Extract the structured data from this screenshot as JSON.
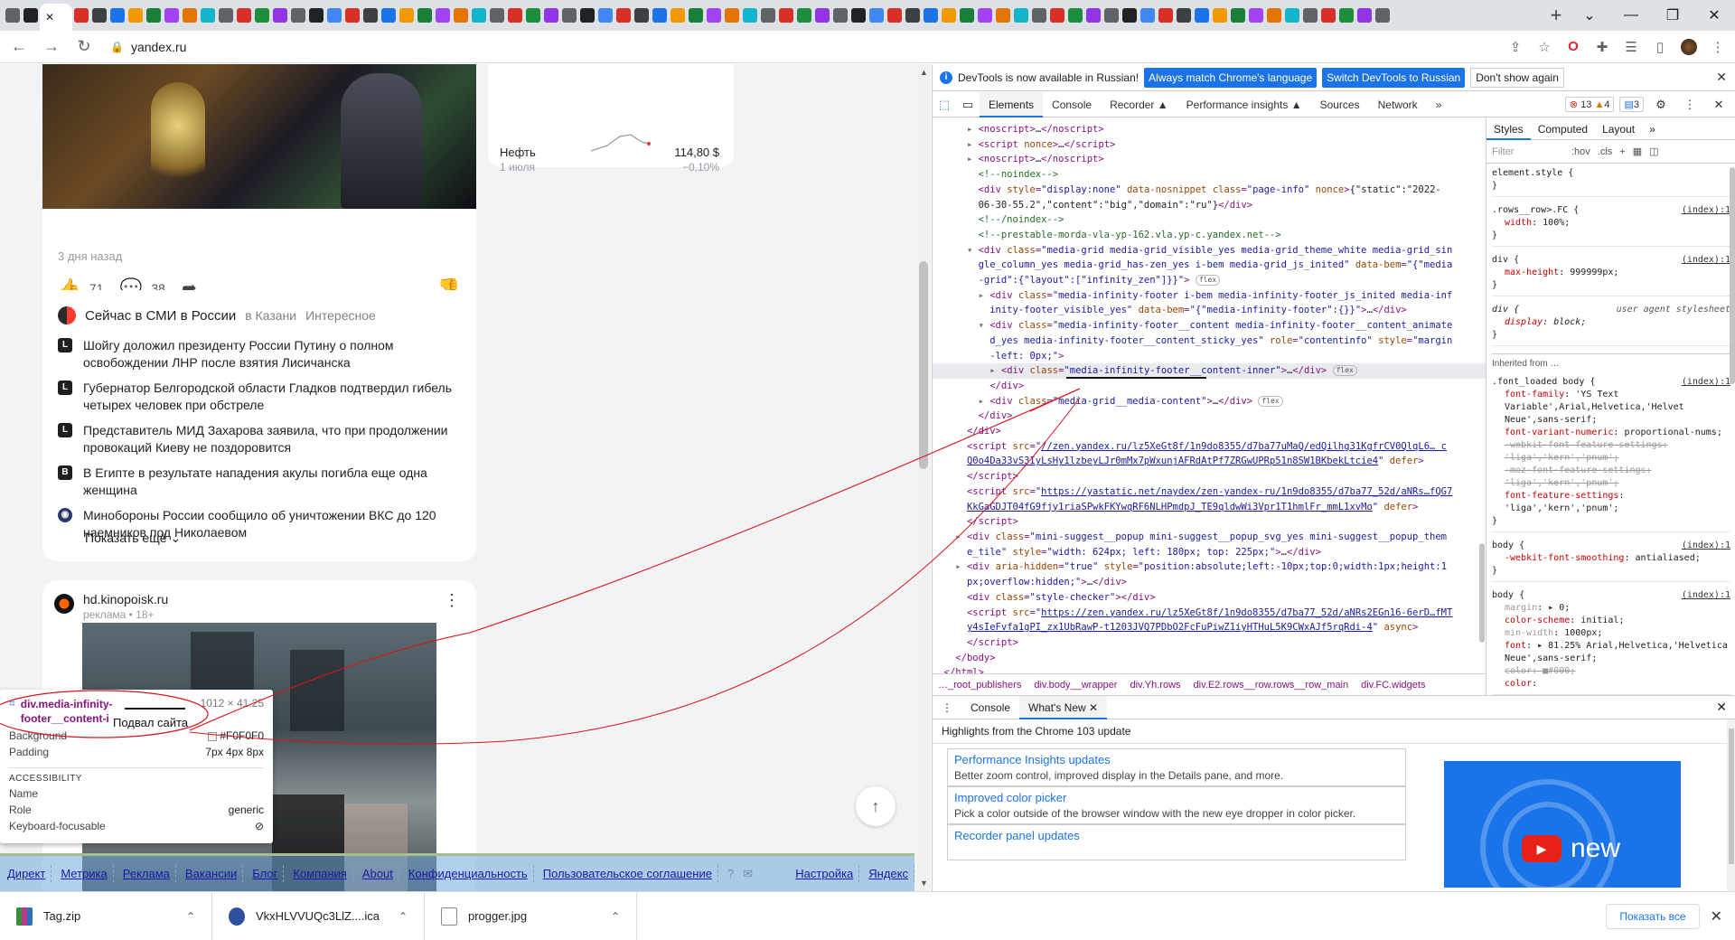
{
  "browser": {
    "url": "yandex.ru",
    "new_tab": "+",
    "win_min": "—",
    "win_max": "❐",
    "win_close": "✕",
    "back": "←",
    "forward": "→",
    "reload": "↻",
    "lock": "🔒",
    "active_tab_close": "✕"
  },
  "page": {
    "card1": {
      "date": "3 дня назад",
      "likes": "71",
      "comments": "38"
    },
    "oil": {
      "name": "Нефть",
      "date": "1 июля",
      "value": "114,80 $",
      "change": "−0,10%"
    },
    "news": {
      "title": "Сейчас в СМИ в России",
      "tab1": "в Казани",
      "tab2": "Интересное",
      "items": [
        {
          "src": "L",
          "text": "Шойгу доложил президенту России Путину о полном освобождении ЛНР после взятия Лисичанска"
        },
        {
          "src": "L",
          "text": "Губернатор Белгородской области Гладков подтвердил гибель четырех человек при обстреле"
        },
        {
          "src": "L",
          "text": "Представитель МИД Захарова заявила, что при продолжении провокаций Киеву не поздоровится"
        },
        {
          "src": "B",
          "text": "В Египте в результате нападения акулы погибла еще одна женщина"
        },
        {
          "src": "◉",
          "text": "Минобороны России сообщило об уничтожении ВКС до 120 наемников под Николаевом"
        }
      ],
      "more": "Показать ещё"
    },
    "ad": {
      "site": "hd.kinopoisk.ru",
      "label": "реклама • 18+"
    },
    "footer_links": [
      "Директ",
      "Метрика",
      "Реклама",
      "Вакансии",
      "Блог",
      "Компания",
      "About",
      "Конфиденциальность",
      "Пользовательское соглашение"
    ],
    "footer_right": [
      "Настройка",
      "Яндекс"
    ],
    "footer_label": "Подвал сайта"
  },
  "inspect": {
    "selector": "div.media-infinity-footer__content-inner",
    "dims": "1012 × 41.25",
    "background_label": "Background",
    "background_value": "#F0F0F0",
    "padding_label": "Padding",
    "padding_value": "7px 4px 8px",
    "accessibility": "ACCESSIBILITY",
    "name_label": "Name",
    "role_label": "Role",
    "role_value": "generic",
    "kb_label": "Keyboard-focusable",
    "kb_value": "⊘"
  },
  "devtools": {
    "banner_text": "DevTools is now available in Russian!",
    "banner_btn1": "Always match Chrome's language",
    "banner_btn2": "Switch DevTools to Russian",
    "banner_btn3": "Don't show again",
    "tabs": [
      "Elements",
      "Console",
      "Recorder ▲",
      "Performance insights ▲",
      "Sources",
      "Network",
      "»"
    ],
    "errors": "13",
    "warnings": "4",
    "issues": "3",
    "breadcrumbs": [
      "…_root_publishers",
      "div.body__wrapper",
      "div.Yh.rows",
      "div.E2.rows__row.rows__row_main",
      "div.FC.widgets"
    ],
    "styles_tabs": [
      "Styles",
      "Computed",
      "Layout",
      "»"
    ],
    "filter": "Filter",
    "hov": ":hov",
    "cls": ".cls",
    "inherited": "Inherited from",
    "drawer_tabs": [
      "Console",
      "What's New"
    ],
    "drawer_title": "Highlights from the Chrome 103 update",
    "whatsnew": [
      {
        "h": "Performance Insights updates",
        "d": "Better zoom control, improved display in the Details pane, and more."
      },
      {
        "h": "Improved color picker",
        "d": "Pick a color outside of the browser window with the new eye dropper in color picker."
      },
      {
        "h": "Recorder panel updates",
        "d": ""
      }
    ],
    "video_text": "new"
  },
  "downloads": {
    "items": [
      "Tag.zip",
      "VkxHLVVUQc3LlZ....ica",
      "progger.jpg"
    ],
    "show_all": "Показать все",
    "close": "✕"
  }
}
